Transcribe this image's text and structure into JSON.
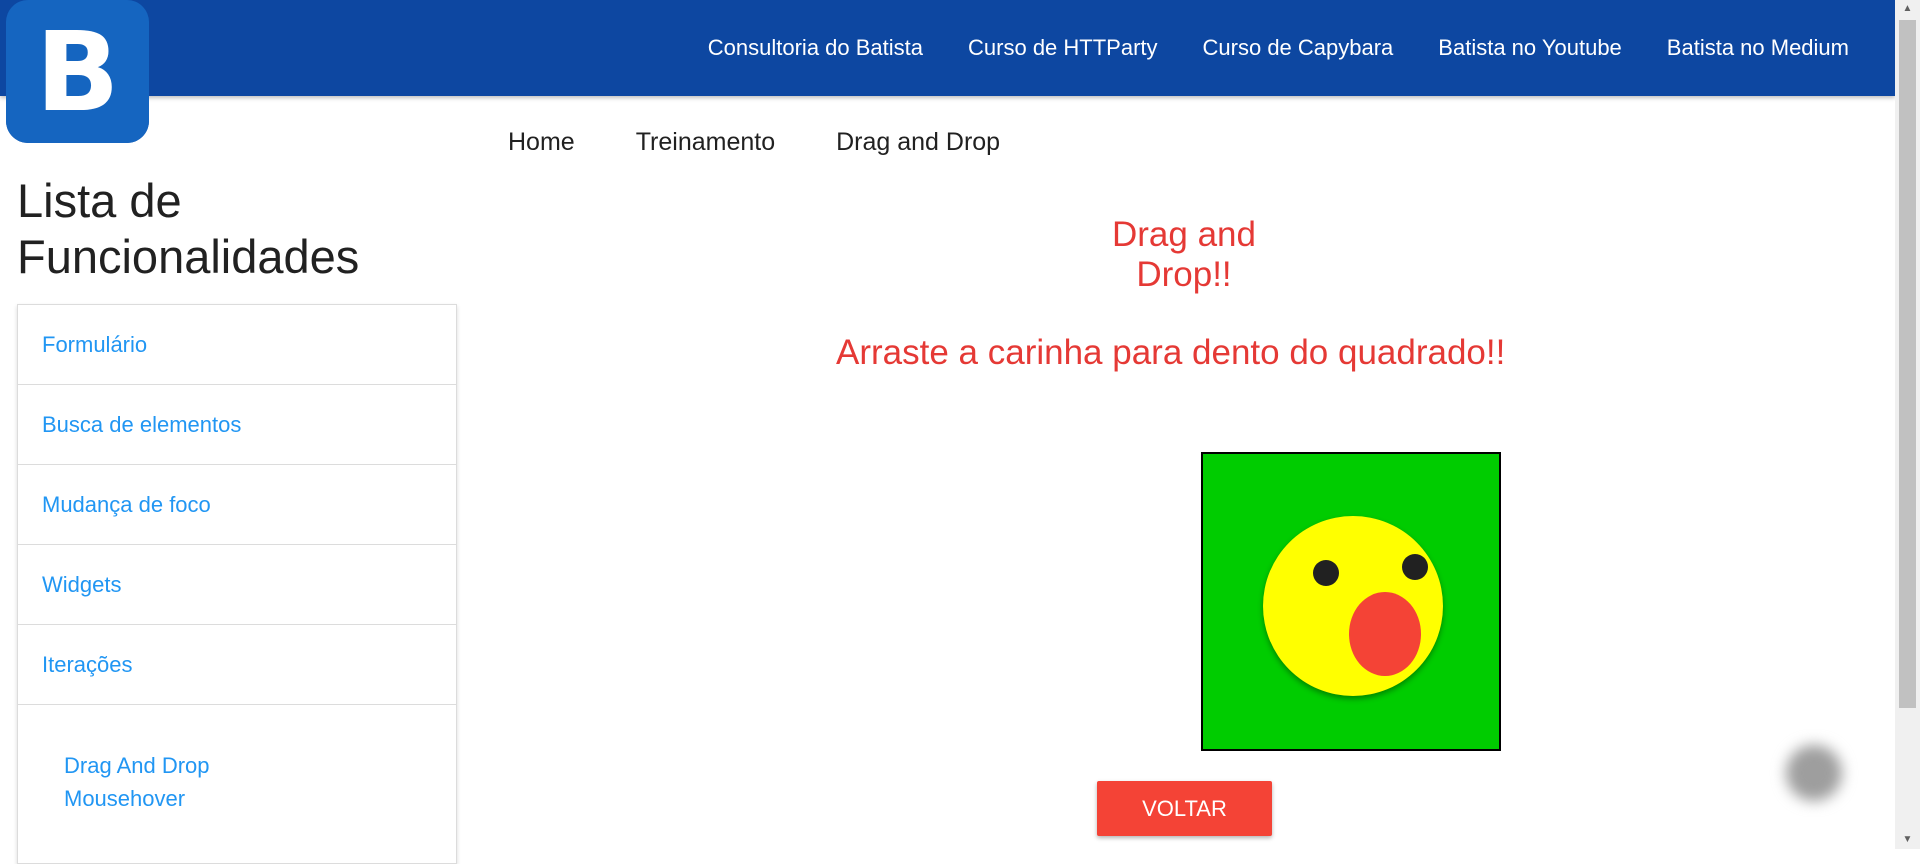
{
  "logo": {
    "letter": "B"
  },
  "nav": {
    "links": [
      "Consultoria do Batista",
      "Curso de HTTParty",
      "Curso de Capybara",
      "Batista no Youtube",
      "Batista no Medium"
    ]
  },
  "breadcrumb": [
    "Home",
    "Treinamento",
    "Drag and Drop"
  ],
  "sidebar": {
    "title": "Lista de Funcionalidades",
    "items": [
      "Formulário",
      "Busca de elementos",
      "Mudança de foco",
      "Widgets",
      "Iterações"
    ],
    "subitems": [
      "Drag And Drop",
      "Mousehover"
    ]
  },
  "main": {
    "title": "Drag and Drop!!",
    "instruction": "Arraste a carinha para dento do quadrado!!",
    "back_button": "VOLTAR"
  },
  "colors": {
    "header": "#0d47a1",
    "accent_red": "#e53935",
    "link_blue": "#2196f3",
    "drop_green": "#00cc00",
    "face_yellow": "#ffff00"
  },
  "icons": {
    "face": "surprised-face-icon"
  }
}
